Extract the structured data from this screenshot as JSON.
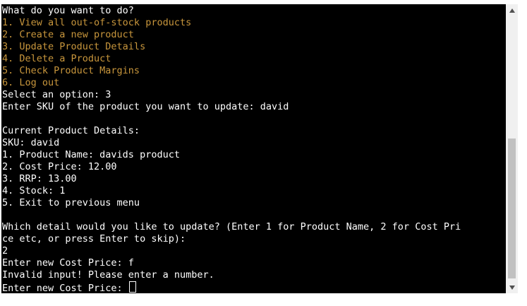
{
  "colors": {
    "background": "#000000",
    "text": "#ffffff",
    "menu_option": "#c8963c",
    "scrollbar_track": "#f0f0f0",
    "scrollbar_thumb": "#c1c1c1"
  },
  "terminal": {
    "prompt_header": "What do you want to do?",
    "menu": [
      "1. View all out-of-stock products",
      "2. Create a new product",
      "3. Update Product Details",
      "4. Delete a Product",
      "5. Check Product Margins",
      "6. Log out"
    ],
    "select_option": "Select an option: 3",
    "enter_sku": "Enter SKU of the product you want to update: david",
    "blank_1": "",
    "details_header": "Current Product Details:",
    "sku": "SKU: david",
    "details": [
      "1. Product Name: davids product",
      "2. Cost Price: 12.00",
      "3. RRP: 13.00",
      "4. Stock: 1",
      "5. Exit to previous menu"
    ],
    "blank_2": "",
    "which_detail_line1": "Which detail would you like to update? (Enter 1 for Product Name, 2 for Cost Pri",
    "which_detail_line2": "ce etc, or press Enter to skip):",
    "user_choice": "2",
    "enter_cost_1": "Enter new Cost Price: f",
    "invalid_input": "Invalid input! Please enter a number.",
    "enter_cost_2": "Enter new Cost Price: "
  },
  "scrollbar": {
    "up_icon": "triangle-up-icon",
    "down_icon": "triangle-down-icon"
  }
}
